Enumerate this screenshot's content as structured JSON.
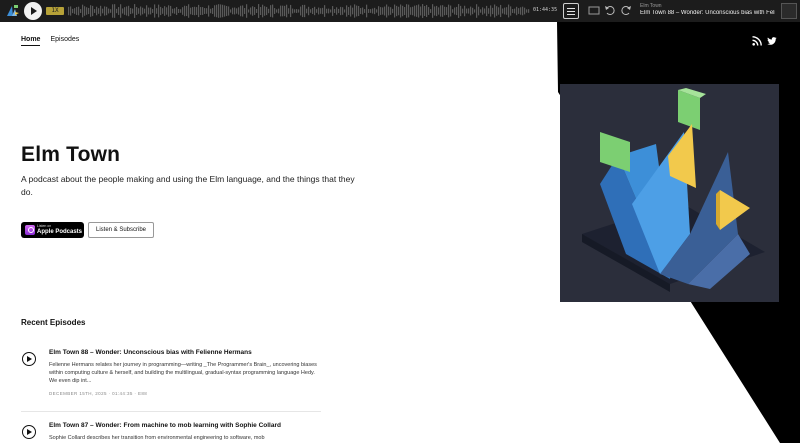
{
  "player": {
    "speed": "1X",
    "time": "01:44:35",
    "now_playing_label": "Elm Town",
    "now_playing_title": "Elm Town 88 – Wonder: Unconscious bias with Felienn..."
  },
  "nav": {
    "home": "Home",
    "episodes": "Episodes"
  },
  "social": [
    "rss-icon",
    "twitter-icon"
  ],
  "podcast": {
    "title": "Elm Town",
    "description": "A podcast about the people making and using the Elm language, and the things that they do."
  },
  "subscribe": {
    "apple_small": "Listen on",
    "apple_label": "Apple Podcasts",
    "listen_label": "Listen & Subscribe"
  },
  "recent": {
    "heading": "Recent Episodes",
    "episodes": [
      {
        "title": "Elm Town 88 – Wonder: Unconscious bias with Felienne Hermans",
        "summary": "Felienne Hermans relates her journey in programming—writing _The Programmer's Brain_, uncovering biases within computing culture & herself, and building the multilingual, gradual-syntax programming language Hedy. We even dip int...",
        "meta": "DECEMBER 15TH, 2025 · 01:44:35 · E88"
      },
      {
        "title": "Elm Town 87 – Wonder: From machine to mob learning with Sophie Collard",
        "summary": "Sophie Collard describes her transition from environmental engineering to software, mob",
        "meta": ""
      }
    ]
  },
  "colors": {
    "black": "#000000",
    "artwork_bg": "#2b2e3b",
    "accent_yellow": "#f2c94c",
    "accent_green": "#7ccf72",
    "accent_blue": "#3d8fd8"
  }
}
